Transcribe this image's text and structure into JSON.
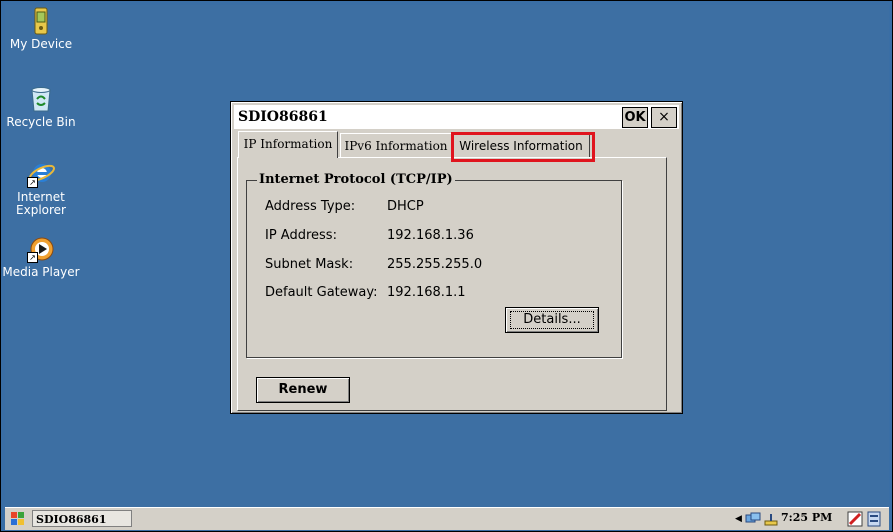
{
  "desktop": {
    "icons": [
      {
        "label": "My Device",
        "icon": "my-device-icon"
      },
      {
        "label": "Recycle Bin",
        "icon": "recycle-bin-icon"
      },
      {
        "label": "Internet Explorer",
        "label_line1": "Internet",
        "label_line2": "Explorer",
        "icon": "internet-explorer-icon"
      },
      {
        "label": "Media Player",
        "icon": "media-player-icon"
      }
    ]
  },
  "dialog": {
    "title": "SDIO86861",
    "ok_label": "OK",
    "close_label": "×",
    "tabs": [
      {
        "label": "IP Information",
        "active": true
      },
      {
        "label": "IPv6 Information",
        "active": false
      },
      {
        "label": "Wireless Information",
        "active": false,
        "highlighted": true
      }
    ],
    "group_title": "Internet Protocol (TCP/IP)",
    "fields": [
      {
        "label": "Address Type:",
        "value": "DHCP"
      },
      {
        "label": "IP Address:",
        "value": "192.168.1.36"
      },
      {
        "label": "Subnet Mask:",
        "value": "255.255.255.0"
      },
      {
        "label": "Default Gateway:",
        "value": "192.168.1.1"
      }
    ],
    "details_label": "Details...",
    "renew_label": "Renew"
  },
  "taskbar": {
    "task_item": "SDIO86861",
    "clock": "7:25 PM"
  },
  "colors": {
    "desktop": "#3d6fa3",
    "dialog": "#d4d0c8",
    "highlight": "#e0141e"
  }
}
